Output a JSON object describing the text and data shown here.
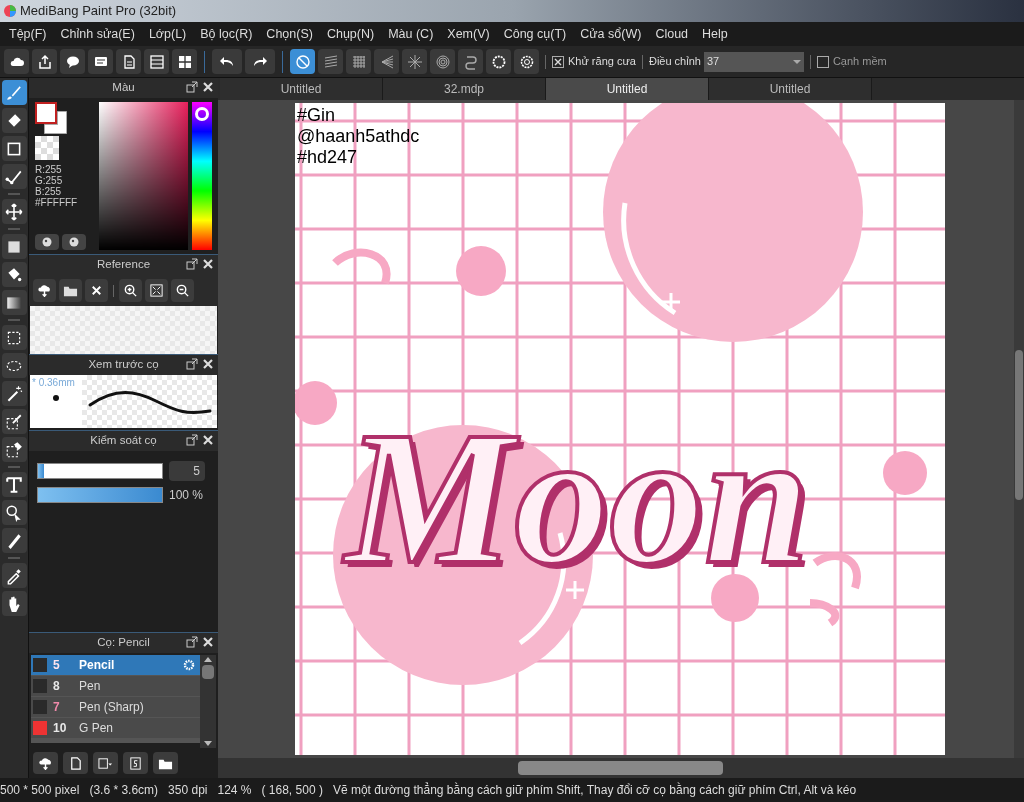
{
  "window": {
    "title": "MediBang Paint Pro (32bit)"
  },
  "menu": [
    "Tệp(F)",
    "Chỉnh sửa(E)",
    "Lớp(L)",
    "Bộ lọc(R)",
    "Chọn(S)",
    "Chụp(N)",
    "Màu (C)",
    "Xem(V)",
    "Công cụ(T)",
    "Cửa sổ(W)",
    "Cloud",
    "Help"
  ],
  "toolbar": {
    "rulers": [
      {
        "selected": true
      },
      {
        "selected": false
      },
      {
        "selected": false
      },
      {
        "selected": false
      },
      {
        "selected": false
      },
      {
        "selected": false
      },
      {
        "selected": false
      },
      {
        "selected": false
      },
      {
        "selected": false
      }
    ],
    "antialias": {
      "label": "Khử răng cưa",
      "checked": true
    },
    "adjust_label": "Điều chỉnh",
    "adjust_value": "37",
    "soft_edge": {
      "label": "Cạnh mềm",
      "checked": false
    }
  },
  "tools": [
    {
      "selected": true
    },
    {
      "selected": false
    },
    {
      "selected": false
    },
    {
      "selected": false
    },
    {
      "selected": false
    },
    {
      "selected": false
    },
    {
      "selected": false
    },
    {
      "selected": false
    },
    {
      "selected": false
    },
    {
      "selected": false
    },
    {
      "selected": false
    },
    {
      "selected": false
    },
    {
      "selected": false
    },
    {
      "selected": false
    },
    {
      "selected": false
    },
    {
      "selected": false
    },
    {
      "selected": false
    },
    {
      "selected": false
    }
  ],
  "color_panel": {
    "title": "Màu",
    "r": "R:255",
    "g": "G:255",
    "b": "B:255",
    "hex": "#FFFFFF",
    "hue": {
      "level": 0.04
    }
  },
  "reference_panel": {
    "title": "Reference"
  },
  "brush_preview": {
    "title": "Xem trước cọ",
    "size": "* 0.36mm"
  },
  "brush_control": {
    "title": "Kiểm soát cọ",
    "size": {
      "level": 0.05,
      "value": "5"
    },
    "opacity": {
      "level": 1,
      "value": "100 %"
    }
  },
  "brush_list": {
    "title": "Cọ: Pencil",
    "items": [
      {
        "number": "5",
        "name": "Pencil",
        "color": "#2a2a2a",
        "highlighted": true,
        "selected": true
      },
      {
        "number": "8",
        "name": "Pen",
        "color": "#2a2a2a",
        "highlighted": false,
        "selected": false
      },
      {
        "number": "7",
        "name": "Pen (Sharp)",
        "color": "#2a2a2a",
        "highlighted": true,
        "selected": false
      },
      {
        "number": "10",
        "name": "G Pen",
        "color": "#ee3333",
        "highlighted": false,
        "selected": false
      }
    ]
  },
  "tabs": [
    {
      "label": "Untitled",
      "selected": false
    },
    {
      "label": "32.mdp",
      "selected": false
    },
    {
      "label": "Untitled",
      "selected": true
    },
    {
      "label": "Untitled",
      "selected": false
    }
  ],
  "canvas": {
    "captions": [
      "#Gin",
      "@haanh5athdc",
      "#hd247"
    ],
    "lettering": "Moon"
  },
  "status_bar": [
    "500 * 500 pixel",
    "(3.6 * 3.6cm)",
    "350 dpi",
    "124 %",
    "( 168, 500 )",
    "Vẽ một đường thẳng bằng cách giữ phím Shift, Thay đổi cỡ cọ bằng cách giữ phím Ctrl, Alt và kéo"
  ]
}
